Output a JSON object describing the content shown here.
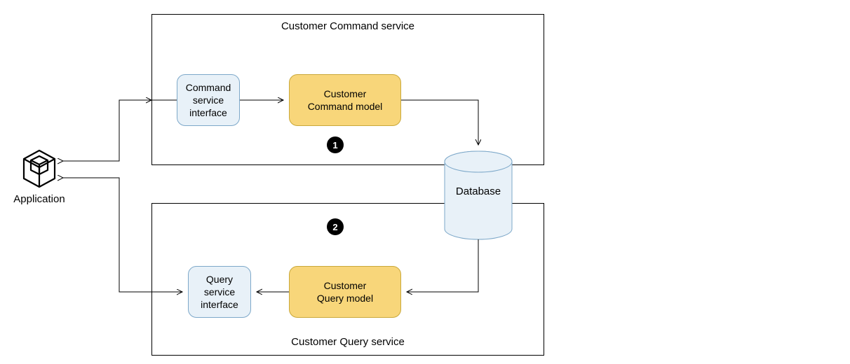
{
  "application": {
    "label": "Application",
    "icon": "cube-icon"
  },
  "commandService": {
    "title": "Customer Command service",
    "interface": {
      "line1": "Command",
      "line2": "service",
      "line3": "interface"
    },
    "model": {
      "line1": "Customer",
      "line2": "Command model"
    }
  },
  "queryService": {
    "title": "Customer Query service",
    "interface": {
      "line1": "Query",
      "line2": "service",
      "line3": "interface"
    },
    "model": {
      "line1": "Customer",
      "line2": "Query model"
    }
  },
  "database": {
    "label": "Database"
  },
  "markers": {
    "one": "1",
    "two": "2"
  }
}
